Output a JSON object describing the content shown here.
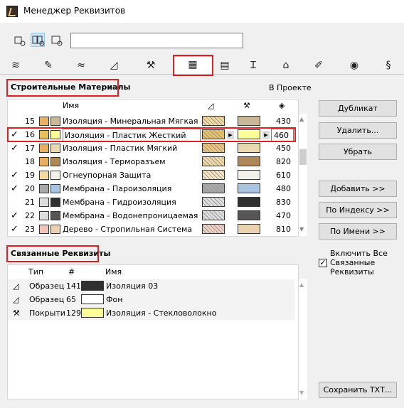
{
  "window": {
    "title": "Менеджер Реквизитов"
  },
  "toolbar": {
    "search_value": "",
    "view_buttons": [
      "list-view-icon",
      "detail-view-icon",
      "preview-view-icon"
    ]
  },
  "tabs": [
    "layers-icon",
    "pen-icon",
    "line-type-icon",
    "fill-icon",
    "surface-icon",
    "building-materials-icon",
    "composite-icon",
    "profile-icon",
    "zone-icon",
    "mep-icon",
    "city-icon",
    "markup-icon"
  ],
  "materials": {
    "section_title": "Строительные Материалы",
    "in_project_label": "В Проекте",
    "col_name": "Имя",
    "rows": [
      {
        "check": "",
        "num": "15",
        "name": "Изоляция - Минеральная Мягкая",
        "c1": "#e8b060",
        "c2": "#c8b898",
        "fill": "#f3d9a0",
        "surf": "#c8b898",
        "val": "430"
      },
      {
        "check": "✓",
        "num": "16",
        "name": "Изоляция - Пластик Жесткий",
        "c1": "#e8c060",
        "c2": "#ffff99",
        "fill": "#e8c060",
        "surf": "#ffff99",
        "val": "460"
      },
      {
        "check": "✓",
        "num": "17",
        "name": "Изоляция - Пластик Мягкий",
        "c1": "#e8b060",
        "c2": "#e8d8b0",
        "fill": "#f0c478",
        "surf": "#e8d8b0",
        "val": "450"
      },
      {
        "check": "",
        "num": "18",
        "name": "Изоляция - Терморазъем",
        "c1": "#e8b060",
        "c2": "#b08858",
        "fill": "#f3d9a0",
        "surf": "#b08858",
        "val": "820"
      },
      {
        "check": "✓",
        "num": "19",
        "name": "Огнеупорная Защита",
        "c1": "#f3d9a0",
        "c2": "#f2f2e8",
        "fill": "#f6e4c4",
        "surf": "#f2f2e8",
        "val": "610"
      },
      {
        "check": "✓",
        "num": "20",
        "name": "Мембрана - Пароизоляция",
        "c1": "#a8a8a8",
        "c2": "#a8c4e0",
        "fill": "#a8a8a8",
        "surf": "#a8c4e0",
        "val": "480"
      },
      {
        "check": "",
        "num": "21",
        "name": "Мембрана - Гидроизоляция",
        "c1": "#dddddd",
        "c2": "#303030",
        "fill": "#dddddd",
        "surf": "#303030",
        "val": "830"
      },
      {
        "check": "✓",
        "num": "22",
        "name": "Мембрана - Водонепроницаемая",
        "c1": "#dddddd",
        "c2": "#555555",
        "fill": "#dddddd",
        "surf": "#555555",
        "val": "470"
      },
      {
        "check": "✓",
        "num": "23",
        "name": "Дерево - Стропильная Система",
        "c1": "#f0c4b8",
        "c2": "#ead2b0",
        "fill": "#f0d0c4",
        "surf": "#ead2b0",
        "val": "810"
      }
    ]
  },
  "related": {
    "section_title": "Связанные Реквизиты",
    "col_type": "Тип",
    "col_num": "#",
    "col_name": "Имя",
    "rows": [
      {
        "icon": "fill-icon",
        "type": "Образец",
        "num": "141",
        "name": "Изоляция 03",
        "color": "#303030"
      },
      {
        "icon": "fill-icon",
        "type": "Образец",
        "num": "65",
        "name": "Фон",
        "color": "#ffffff"
      },
      {
        "icon": "surface-icon",
        "type": "Покрыти",
        "num": "129",
        "name": "Изоляция - Стекловолокно",
        "color": "#ffff99"
      }
    ]
  },
  "buttons": {
    "duplicate": "Дубликат",
    "delete": "Удалить...",
    "remove": "Убрать",
    "add": "Добавить >>",
    "by_index": "По Индексу >>",
    "by_name": "По Имени >>",
    "save_txt": "Сохранить ТХТ..."
  },
  "include_all": {
    "label": "Включить Все\nСвязанные\nРеквизиты",
    "checked": "✓"
  }
}
